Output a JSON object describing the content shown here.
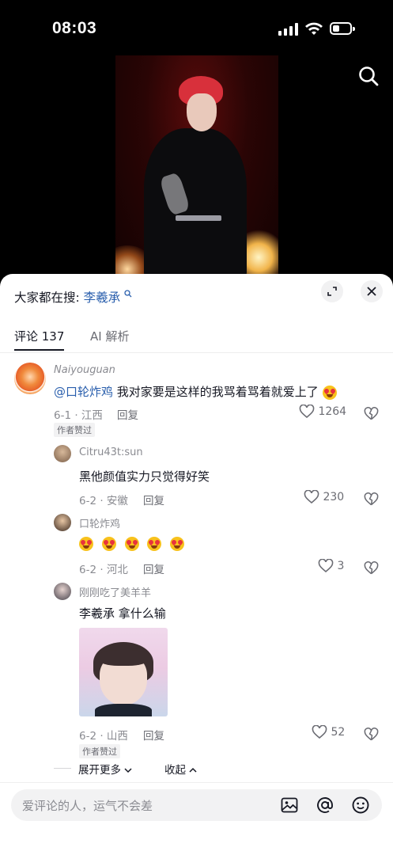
{
  "status_bar": {
    "time": "08:03"
  },
  "sheet": {
    "hot_search_label": "大家都在搜:",
    "hot_search_keyword": "李羲承",
    "tabs": [
      {
        "label": "评论 137",
        "active": true
      },
      {
        "label": "AI 解析",
        "active": false
      }
    ]
  },
  "comments": [
    {
      "user": "Naiyouguan",
      "mention": "@口轮炸鸡",
      "text": " 我对家要是这样的我骂着骂着就爱上了",
      "meta": "6-1 · 江西",
      "reply": "回复",
      "likes": "1264",
      "badge": "作者赞过"
    },
    {
      "user": "Citru43t:sun",
      "text": "黑他颜值实力只觉得好笑",
      "meta": "6-2 · 安徽",
      "reply": "回复",
      "likes": "230"
    },
    {
      "user": "口轮炸鸡",
      "text": "",
      "meta": "6-2 · 河北",
      "reply": "回复",
      "likes": "3"
    },
    {
      "user": "刚刚吃了美羊羊",
      "text": "李羲承 拿什么输",
      "meta": "6-2 · 山西",
      "reply": "回复",
      "likes": "52",
      "badge": "作者赞过"
    }
  ],
  "expand_more": "展开更多",
  "collapse": "收起",
  "input": {
    "placeholder": "爱评论的人，运气不会差"
  },
  "colors": {
    "accent_blue": "#2a5fad",
    "text": "#161823",
    "muted": "#8a8b91"
  }
}
